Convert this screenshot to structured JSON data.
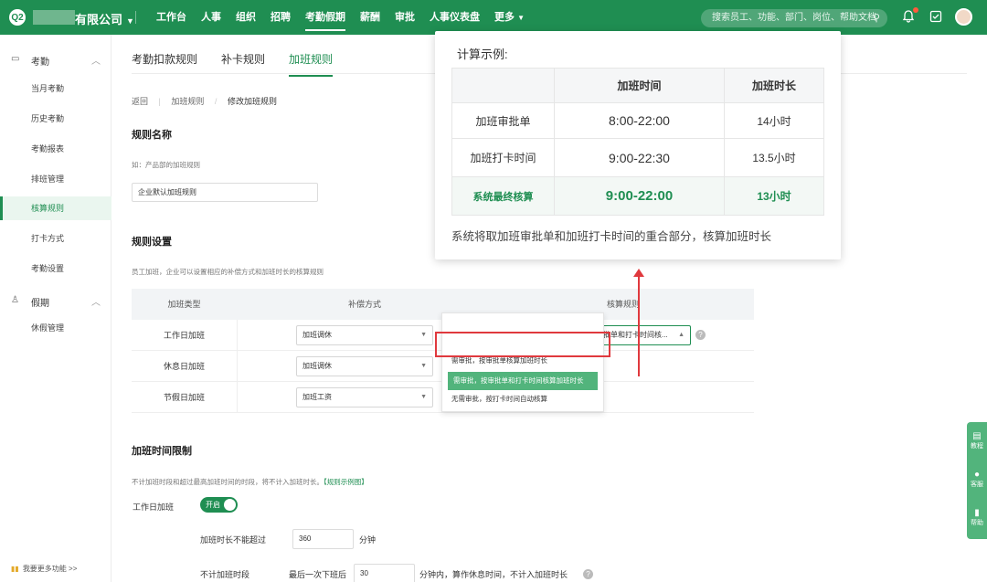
{
  "topbar": {
    "logo": "Q2",
    "company": "有限公司",
    "nav": [
      "工作台",
      "人事",
      "组织",
      "招聘",
      "考勤假期",
      "薪酬",
      "审批",
      "人事仪表盘",
      "更多"
    ],
    "active_nav": "考勤假期",
    "search_placeholder": "搜索员工、功能、部门、岗位、帮助文档",
    "icons": [
      "bell-icon",
      "checklist-icon",
      "avatar"
    ],
    "brand_color": "#1f8e52"
  },
  "sidebar": {
    "groups": [
      {
        "label": "考勤",
        "icon": "calendar-icon"
      },
      {
        "label": "假期",
        "icon": "user-icon"
      }
    ],
    "items": [
      "当月考勤",
      "历史考勤",
      "考勤报表",
      "排班管理",
      "核算规则",
      "打卡方式",
      "考勤设置",
      "休假管理"
    ],
    "active_item": "核算规则",
    "bottom": "我要更多功能 >>"
  },
  "main": {
    "tabs": [
      "考勤扣款规则",
      "补卡规则",
      "加班规则"
    ],
    "breadcrumb": [
      "返回",
      "加班规则",
      "修改加班规则"
    ],
    "rule_name_title": "规则名称",
    "rule_name_hint": "如：产品部的加班规则",
    "rule_name_value": "企业默认加班规则",
    "rule_setting_title": "规则设置",
    "rule_setting_hint": "员工加班，企业可以设置相应的补偿方式和加班时长的核算规则",
    "table_headers": [
      "加班类型",
      "补偿方式",
      "核算规则"
    ],
    "rows": [
      {
        "type": "工作日加班",
        "comp": "加班调休",
        "rule": "需审批，按审批单和打卡时间核..."
      },
      {
        "type": "休息日加班",
        "comp": "加班调休",
        "rule": ""
      },
      {
        "type": "节假日加班",
        "comp": "加班工资",
        "rule": ""
      }
    ],
    "dropdown_options": [
      "需审批，按审批单核算加班时长",
      "需审批，按审批单和打卡时间核算加班时长",
      "无需审批，按打卡时间自动核算"
    ],
    "dropdown_selected": 1,
    "limit_title": "加班时间限制",
    "limit_hint": "不计加班时段和超过最高加班时间的时段，将不计入加班时长。",
    "limit_hint_link": "【规则示例图】",
    "workday_label": "工作日加班",
    "toggle_label": "开启",
    "max_label": "加班时长不能超过",
    "max_value": "360",
    "max_unit": "分钟",
    "exclude_label": "不计加班时段",
    "exclude_prefix": "最后一次下班后",
    "exclude_value": "30",
    "exclude_suffix": "分钟内，算作休息时间，不计入加班时长"
  },
  "popup": {
    "title": "计算示例:",
    "headers": [
      "",
      "加班时间",
      "加班时长"
    ],
    "rows": [
      {
        "label": "加班审批单",
        "time": "8:00-22:00",
        "duration": "14小时"
      },
      {
        "label": "加班打卡时间",
        "time": "9:00-22:30",
        "duration": "13.5小时"
      },
      {
        "label": "系统最终核算",
        "time": "9:00-22:00",
        "duration": "13小时"
      }
    ],
    "note": "系统将取加班审批单和加班打卡时间的重合部分，核算加班时长"
  },
  "floating": [
    "教程",
    "客服",
    "帮助"
  ]
}
